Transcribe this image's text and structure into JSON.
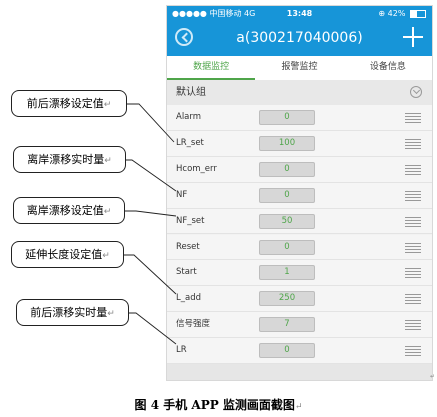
{
  "status_bar": {
    "carrier": "●●●●● 中国移动  4G",
    "time": "13:48",
    "battery": "⊕  42%",
    "battery_level": 0.42
  },
  "header": {
    "title": "a(300217040006)"
  },
  "tabs": [
    {
      "label": "数据监控",
      "active": true
    },
    {
      "label": "报警监控",
      "active": false
    },
    {
      "label": "设备信息",
      "active": false
    }
  ],
  "group": {
    "name": "默认组"
  },
  "rows": [
    {
      "label": "Alarm",
      "value": "0"
    },
    {
      "label": "LR_set",
      "value": "100"
    },
    {
      "label": "Hcom_err",
      "value": "0"
    },
    {
      "label": "NF",
      "value": "0"
    },
    {
      "label": "NF_set",
      "value": "50"
    },
    {
      "label": "Reset",
      "value": "0"
    },
    {
      "label": "Start",
      "value": "1"
    },
    {
      "label": "L_add",
      "value": "250"
    },
    {
      "label": "信号强度",
      "value": "7"
    },
    {
      "label": "LR",
      "value": "0"
    }
  ],
  "callouts": [
    {
      "text": "前后漂移设定值",
      "target": "LR_set"
    },
    {
      "text": "离岸漂移实时量",
      "target": "NF"
    },
    {
      "text": "离岸漂移设定值",
      "target": "NF_set"
    },
    {
      "text": "延伸长度设定值",
      "target": "L_add"
    },
    {
      "text": "前后漂移实时量",
      "target": "LR"
    }
  ],
  "callout_end_mark": "↵",
  "caption": "图 4   手机 APP 监测画面截图",
  "corner_mark": "↵",
  "colors": {
    "app_bar": "#1795d8",
    "active_tab": "#4fa54a",
    "value_text": "#4fa54a"
  }
}
